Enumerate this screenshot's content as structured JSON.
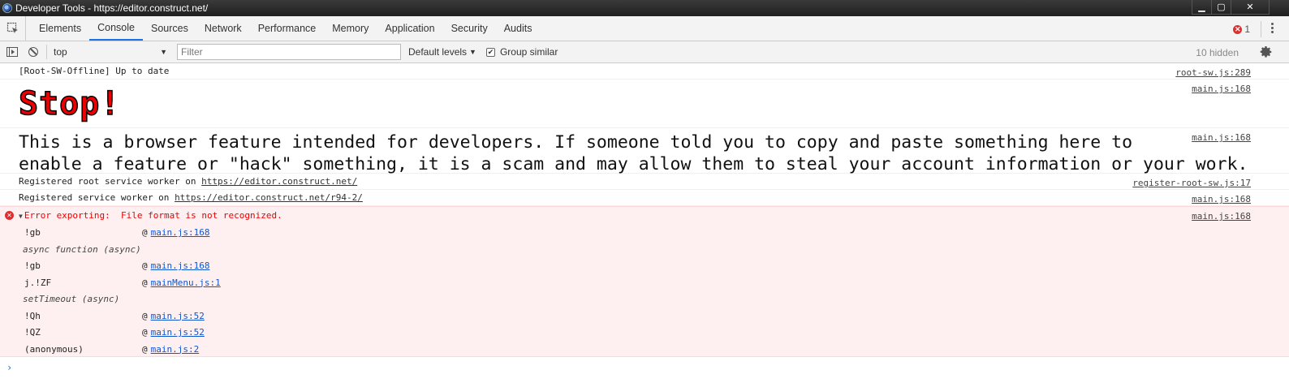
{
  "window": {
    "title": "Developer Tools - https://editor.construct.net/",
    "controls": {
      "minimize": "▁",
      "maximize": "▢",
      "close": "✕"
    }
  },
  "tabs": [
    {
      "label": "Elements",
      "active": false
    },
    {
      "label": "Console",
      "active": true
    },
    {
      "label": "Sources",
      "active": false
    },
    {
      "label": "Network",
      "active": false
    },
    {
      "label": "Performance",
      "active": false
    },
    {
      "label": "Memory",
      "active": false
    },
    {
      "label": "Application",
      "active": false
    },
    {
      "label": "Security",
      "active": false
    },
    {
      "label": "Audits",
      "active": false
    }
  ],
  "error_badge": {
    "count": "1",
    "icon": "error-icon"
  },
  "toolbar": {
    "context": "top",
    "filter_placeholder": "Filter",
    "levels_label": "Default levels",
    "group_similar_label": "Group similar",
    "group_similar_checked": true,
    "checkmark": "✔",
    "hidden_count": "10 hidden"
  },
  "messages": {
    "offline": {
      "text": "[Root-SW-Offline] Up to date",
      "source": "root-sw.js:289"
    },
    "stop": {
      "text": "Stop!",
      "source": "main.js:168"
    },
    "warning": {
      "line1": "This is a browser feature intended for developers. If someone told you to copy and paste something here to",
      "line2": "enable a feature or \"hack\" something, it is a scam and may allow them to steal your account information or your work.",
      "source": "main.js:168"
    },
    "sw_root": {
      "prefix": "Registered root service worker on ",
      "url": "https://editor.construct.net/",
      "source": "register-root-sw.js:17"
    },
    "sw": {
      "prefix": "Registered service worker on ",
      "url": "https://editor.construct.net/r94-2/",
      "source": "main.js:168"
    },
    "error": {
      "text": "Error exporting:  File format is not recognized.",
      "source": "main.js:168",
      "stack": [
        {
          "type": "frame",
          "fn": "!gb",
          "at": "@",
          "link": "main.js:168"
        },
        {
          "type": "async",
          "label": "async function (async)"
        },
        {
          "type": "frame",
          "fn": "!gb",
          "at": "@",
          "link": "main.js:168"
        },
        {
          "type": "frame",
          "fn": "j.!ZF",
          "at": "@",
          "link": "mainMenu.js:1"
        },
        {
          "type": "async",
          "label": "setTimeout (async)"
        },
        {
          "type": "frame",
          "fn": "!Qh",
          "at": "@",
          "link": "main.js:52"
        },
        {
          "type": "frame",
          "fn": "!QZ",
          "at": "@",
          "link": "main.js:52"
        },
        {
          "type": "frame",
          "fn": "(anonymous)",
          "at": "@",
          "link": "main.js:2"
        }
      ]
    }
  },
  "prompt": "›"
}
